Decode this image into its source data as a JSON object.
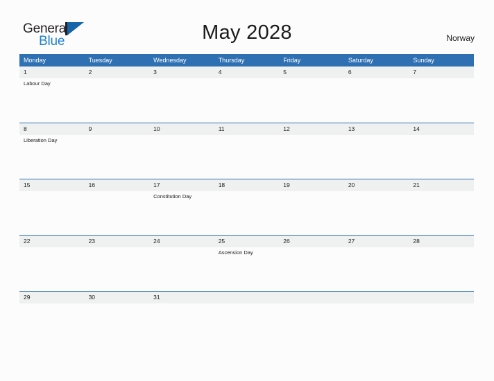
{
  "brand": {
    "name_part1": "General",
    "name_part2": "Blue",
    "flag_icon": "flag-triangle-icon",
    "color_dark": "#231f20",
    "color_blue": "#1f7fd0"
  },
  "header": {
    "title": "May 2028",
    "country": "Norway"
  },
  "colors": {
    "header_bar": "#2f70b3",
    "daynum_band": "#eff0f0",
    "page_background": "#fcfcfc",
    "text": "#1a1a1a"
  },
  "calendar": {
    "month": "May",
    "year": "2028",
    "weekday_headers": [
      "Monday",
      "Tuesday",
      "Wednesday",
      "Thursday",
      "Friday",
      "Saturday",
      "Sunday"
    ],
    "weeks": [
      {
        "days": [
          {
            "number": "1",
            "event": "Labour Day"
          },
          {
            "number": "2",
            "event": ""
          },
          {
            "number": "3",
            "event": ""
          },
          {
            "number": "4",
            "event": ""
          },
          {
            "number": "5",
            "event": ""
          },
          {
            "number": "6",
            "event": ""
          },
          {
            "number": "7",
            "event": ""
          }
        ]
      },
      {
        "days": [
          {
            "number": "8",
            "event": "Liberation Day"
          },
          {
            "number": "9",
            "event": ""
          },
          {
            "number": "10",
            "event": ""
          },
          {
            "number": "11",
            "event": ""
          },
          {
            "number": "12",
            "event": ""
          },
          {
            "number": "13",
            "event": ""
          },
          {
            "number": "14",
            "event": ""
          }
        ]
      },
      {
        "days": [
          {
            "number": "15",
            "event": ""
          },
          {
            "number": "16",
            "event": ""
          },
          {
            "number": "17",
            "event": "Constitution Day"
          },
          {
            "number": "18",
            "event": ""
          },
          {
            "number": "19",
            "event": ""
          },
          {
            "number": "20",
            "event": ""
          },
          {
            "number": "21",
            "event": ""
          }
        ]
      },
      {
        "days": [
          {
            "number": "22",
            "event": ""
          },
          {
            "number": "23",
            "event": ""
          },
          {
            "number": "24",
            "event": ""
          },
          {
            "number": "25",
            "event": "Ascension Day"
          },
          {
            "number": "26",
            "event": ""
          },
          {
            "number": "27",
            "event": ""
          },
          {
            "number": "28",
            "event": ""
          }
        ]
      },
      {
        "days": [
          {
            "number": "29",
            "event": ""
          },
          {
            "number": "30",
            "event": ""
          },
          {
            "number": "31",
            "event": ""
          },
          {
            "number": "",
            "event": ""
          },
          {
            "number": "",
            "event": ""
          },
          {
            "number": "",
            "event": ""
          },
          {
            "number": "",
            "event": ""
          }
        ]
      }
    ]
  }
}
